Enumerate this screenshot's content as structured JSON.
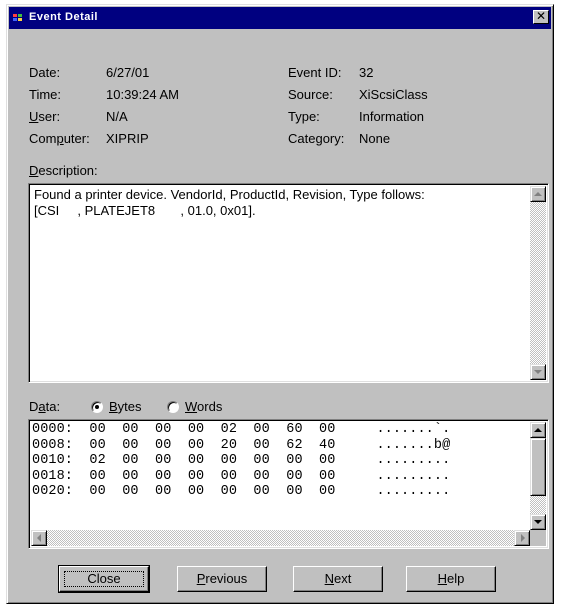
{
  "window": {
    "title": "Event Detail"
  },
  "fields": {
    "date_label": "Date:",
    "date_value": "6/27/01",
    "time_label": "Time:",
    "time_value": "10:39:24 AM",
    "user_label": "User:",
    "user_value": "N/A",
    "computer_label": "Computer:",
    "computer_value": "XIPRIP",
    "event_id_label": "Event ID:",
    "event_id_value": "32",
    "source_label": "Source:",
    "source_value": "XiScsiClass",
    "type_label": "Type:",
    "type_value": "Information",
    "category_label": "Category:",
    "category_value": "None"
  },
  "description": {
    "label": "Description:",
    "lines": [
      "Found a printer device. VendorId, ProductId, Revision, Type follows:",
      "[CSI     , PLATEJET8       , 01.0, 0x01]."
    ]
  },
  "data": {
    "label": "Data:",
    "radio_bytes": "Bytes",
    "radio_words": "Words",
    "selected": "Bytes",
    "rows": [
      "0000:  00  00  00  00  02  00  60  00     .......`.",
      "0008:  00  00  00  00  20  00  62  40     .......b@",
      "0010:  02  00  00  00  00  00  00  00     .........",
      "0018:  00  00  00  00  00  00  00  00     .........",
      "0020:  00  00  00  00  00  00  00  00     ........."
    ]
  },
  "buttons": {
    "close": "Close",
    "previous": "Previous",
    "next": "Next",
    "help": "Help"
  },
  "icons": {
    "close": "close-x-icon",
    "scroll_up": "arrow-up-icon",
    "scroll_down": "arrow-down-icon",
    "scroll_left": "arrow-left-icon",
    "scroll_right": "arrow-right-icon"
  }
}
